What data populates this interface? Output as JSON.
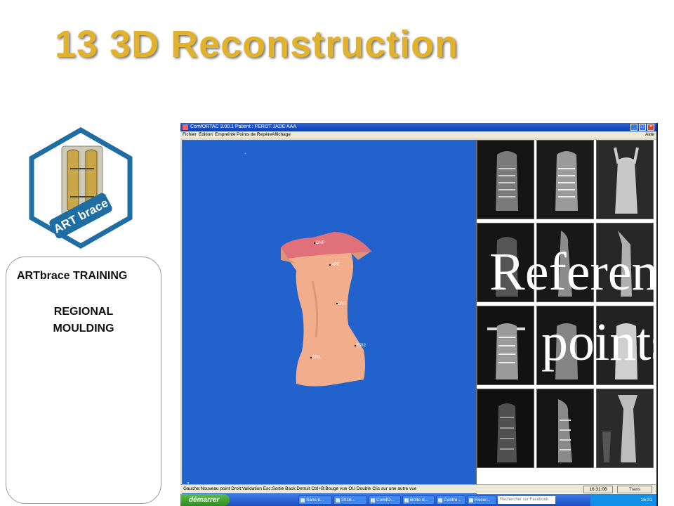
{
  "slide": {
    "title": "13 3D Reconstruction",
    "training_title": "ARTbrace TRAINING",
    "training_sub1": "REGIONAL",
    "training_sub2": "MOULDING",
    "logo_text": "ART brace"
  },
  "app": {
    "titlebar_text": "ComfORTAC 3.00.1   Patient : PEROT JADE AAA",
    "menus": [
      "Fichier",
      "Edition",
      "Empreinte",
      "Points de Repère",
      "Affichage"
    ],
    "menu_help": "Aide",
    "landmarks": [
      "DNP",
      "APE",
      "EPIT",
      "EPI2",
      "EPI1"
    ],
    "overlay_line1": "Referen",
    "overlay_line2": "points",
    "status_text": "Gauche:Nouveau point  Droit:Validation  Esc:Sortie  Back:Detruit  Ctrl+B:Bouge vue  OU  Double Clic sur une autre vue",
    "status_time": "16:31:06",
    "status_mode": "Trans"
  },
  "taskbar": {
    "start": "démarrer",
    "tasks": [
      "Sans ti...",
      "2016...",
      "ComfO...",
      "Boîte d...",
      "Centre...",
      "Recor..."
    ],
    "search_placeholder": "Rechercher sur Facebook",
    "clock": "16:31"
  },
  "colors": {
    "title_gold": "#e2b22a",
    "viewport_blue": "#2262cc",
    "torso_skin": "#f2ae8c",
    "torso_top_pink": "#e0707a"
  }
}
